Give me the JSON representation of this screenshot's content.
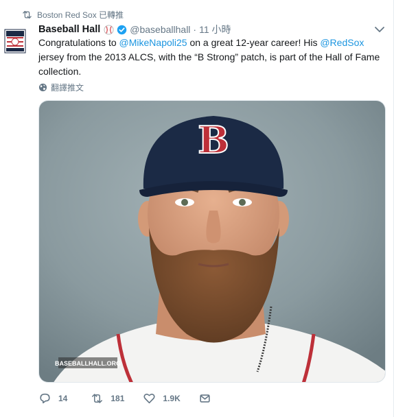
{
  "retweet": {
    "icon": "retweet-icon",
    "text": "Boston Red Sox 已轉推"
  },
  "author": {
    "name": "Baseball Hall",
    "handle": "@baseballhall",
    "separator": "·",
    "time": "11 小時",
    "avatar_icon": "hall-of-fame-logo",
    "emoji_icon": "baseball-icon",
    "verified_icon": "verified-badge-icon"
  },
  "tweet": {
    "t1": "Congratulations to ",
    "mention1": "@MikeNapoli25",
    "t2": " on a great 12-year career! His ",
    "mention2": "@RedSox",
    "t3": " jersey from the 2013 ALCS, with the “B Strong” patch, is part of the Hall of Fame collection."
  },
  "translate": {
    "icon": "globe-icon",
    "label": "翻譯推文"
  },
  "media": {
    "watermark": "BASEBALLHALL.ORG",
    "cap_letter": "B"
  },
  "actions": {
    "reply_count": "14",
    "retweet_count": "181",
    "like_count": "1.9K"
  },
  "colors": {
    "link": "#1b95e0",
    "secondary": "#657786",
    "verified": "#1da1f2",
    "cap": "#1b2a45",
    "sox_red": "#bd3039"
  }
}
